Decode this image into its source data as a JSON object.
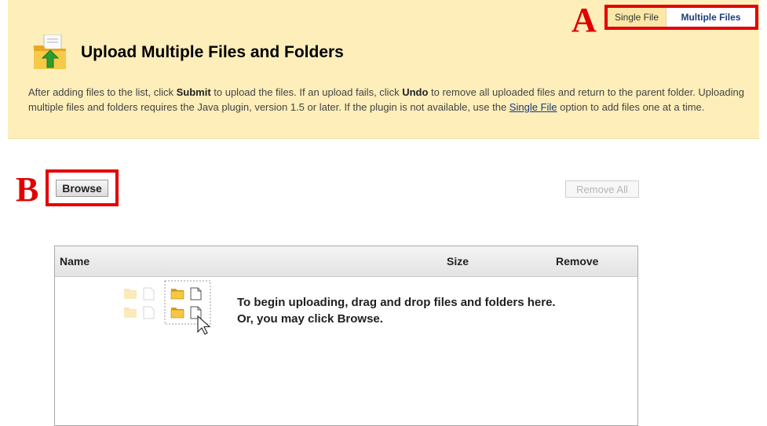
{
  "tabs": {
    "single_file": "Single File",
    "multiple_files": "Multiple Files"
  },
  "annotations": {
    "a": "A",
    "b": "B"
  },
  "header": {
    "title": "Upload Multiple Files and Folders",
    "instructions": {
      "part1": "After adding files to the list, click ",
      "submit": "Submit",
      "part2": " to upload the files. If an upload fails, click ",
      "undo": "Undo",
      "part3": " to remove all uploaded files and return to the parent folder. Uploading multiple files and folders requires the Java plugin, version 1.5 or later. If the plugin is not available, use the ",
      "single_file_link": "Single File",
      "part4": " option to add files one at a time."
    }
  },
  "actions": {
    "browse": "Browse",
    "remove_all": "Remove All"
  },
  "table": {
    "columns": {
      "name": "Name",
      "size": "Size",
      "remove": "Remove"
    },
    "empty_line1": "To begin uploading, drag and drop files and folders here.",
    "empty_line2": "Or, you may click Browse."
  },
  "colors": {
    "header_bg": "#fdeeba",
    "annotation_red": "#e40000",
    "active_tab_text": "#1b3e7a",
    "folder_yellow": "#f5c842"
  },
  "icons": {
    "upload": "upload-folder-icon",
    "folder": "folder-icon",
    "document": "document-icon",
    "cursor": "cursor-icon"
  }
}
